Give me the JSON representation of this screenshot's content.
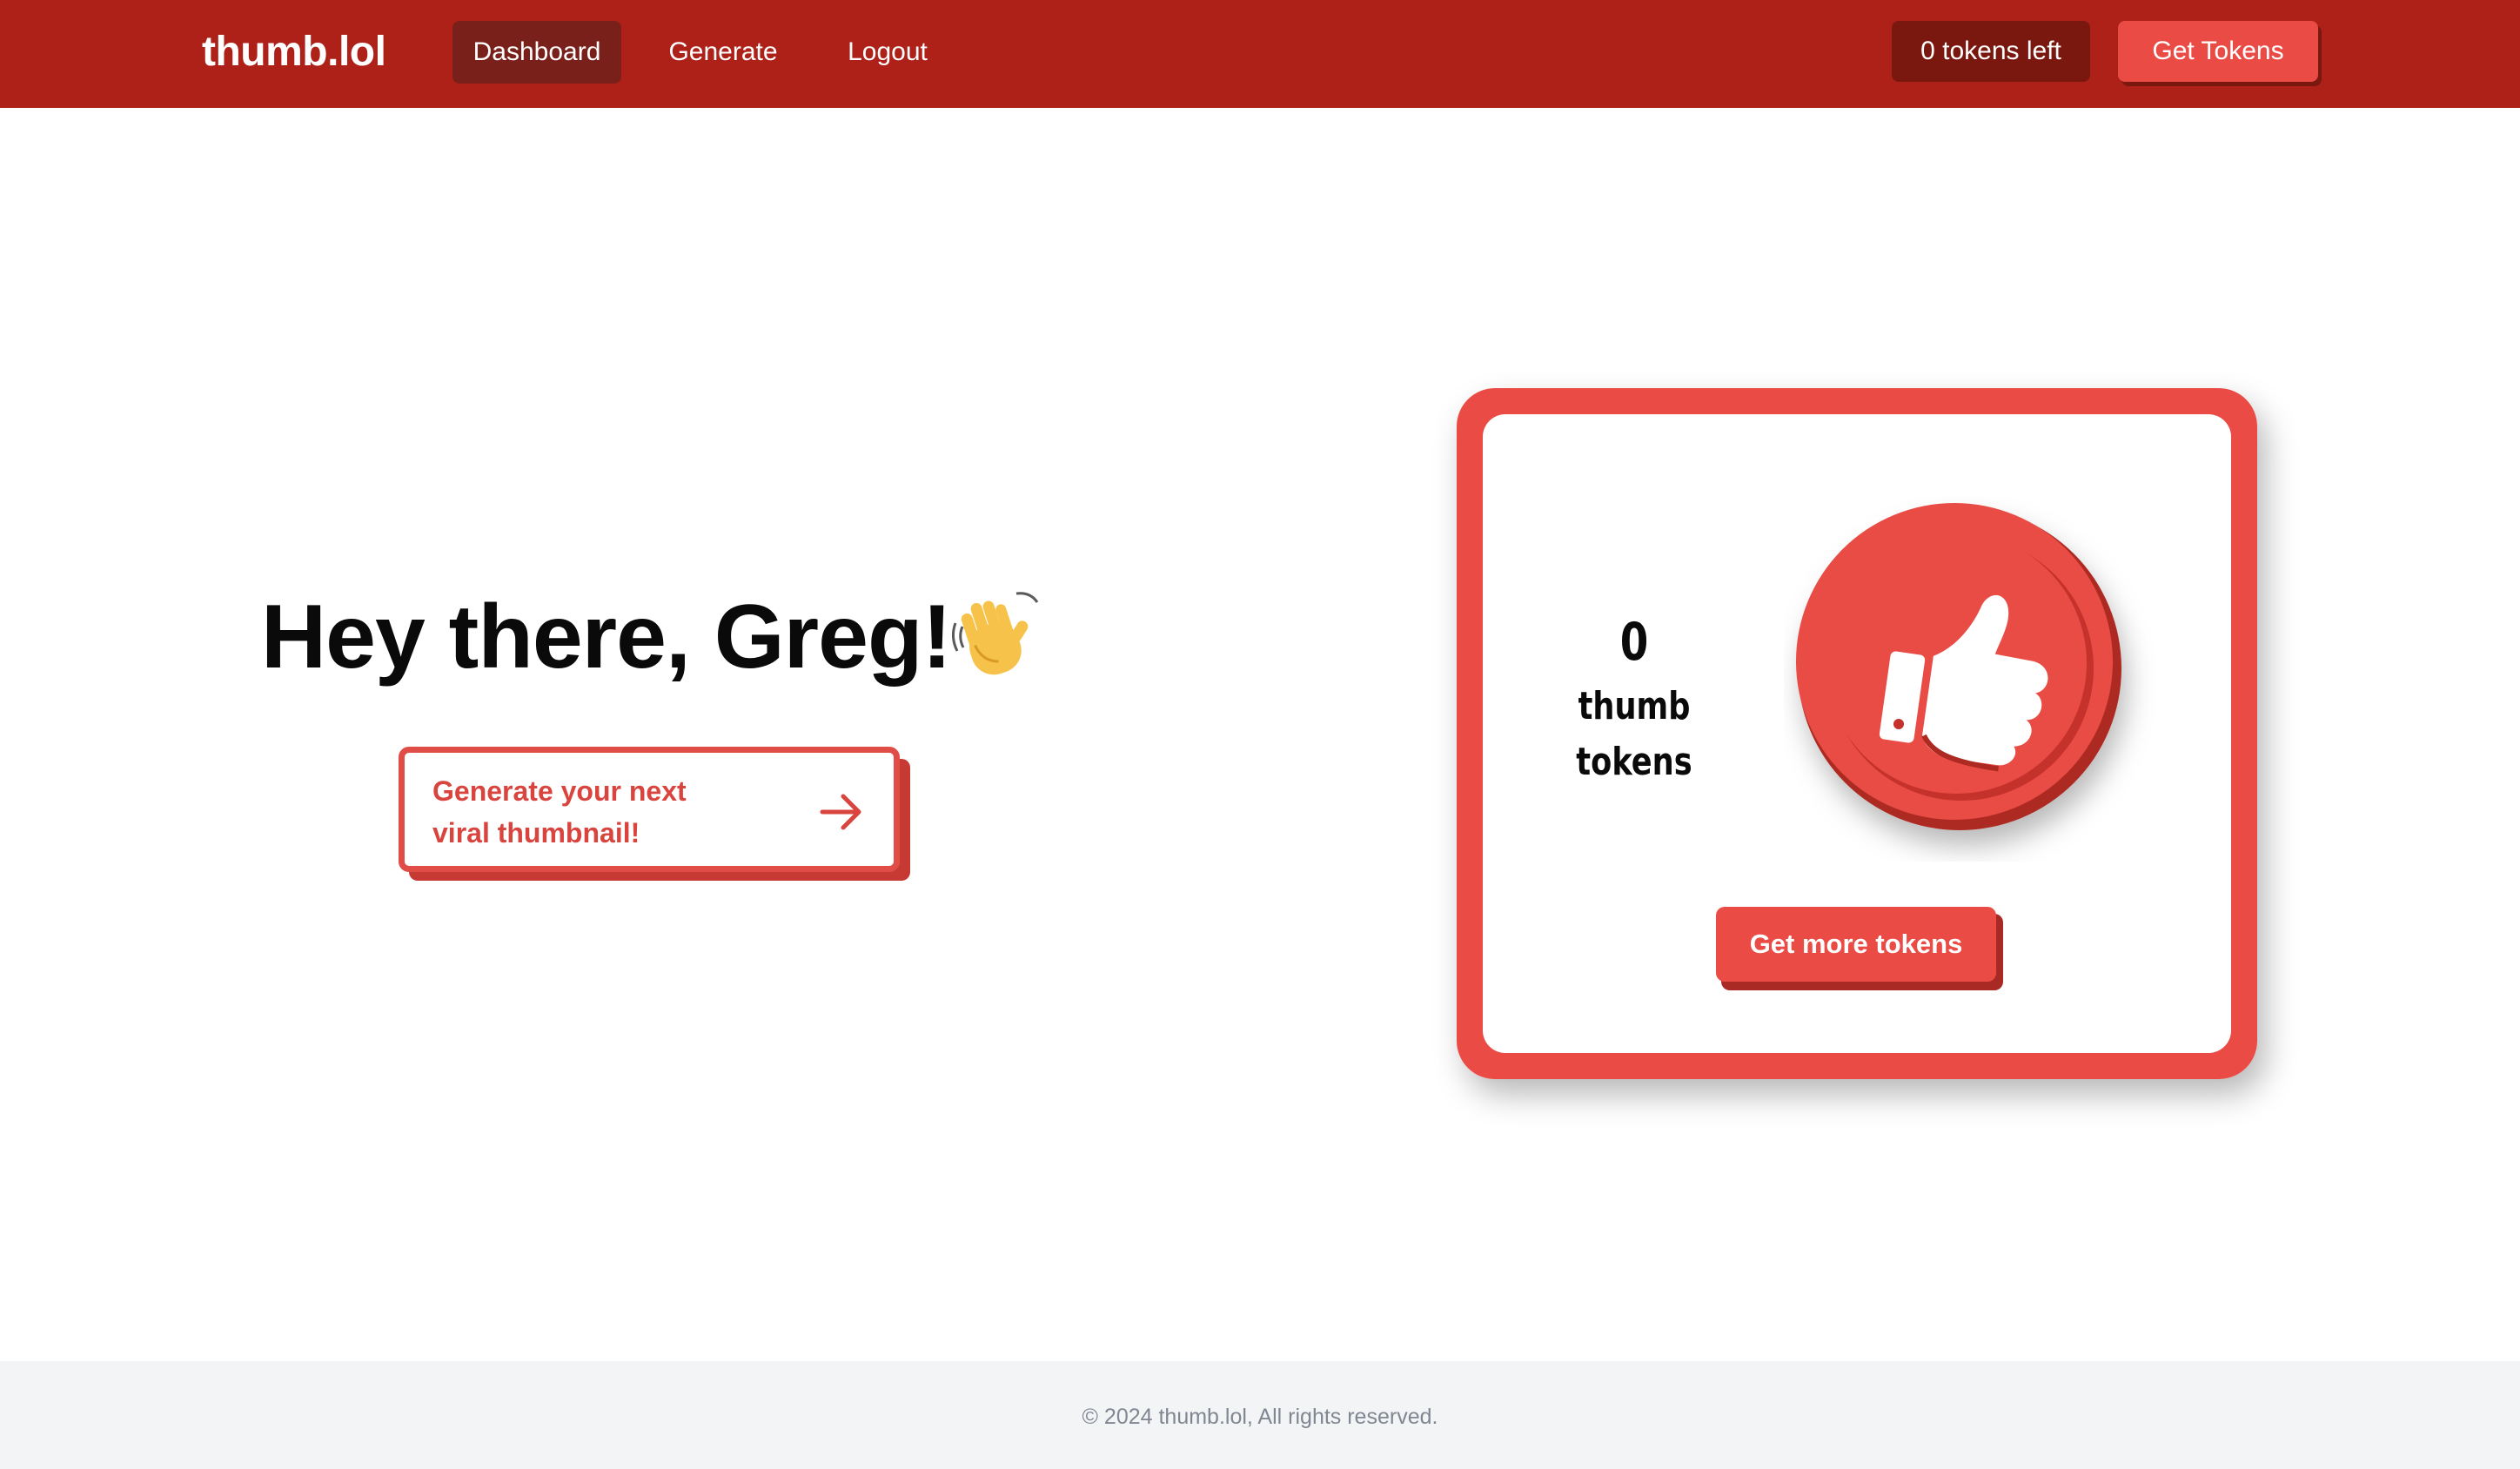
{
  "navbar": {
    "logo": "thumb.lol",
    "links": [
      {
        "label": "Dashboard",
        "active": true
      },
      {
        "label": "Generate",
        "active": false
      },
      {
        "label": "Logout",
        "active": false
      }
    ],
    "tokens_left": "0 tokens left",
    "get_tokens_label": "Get Tokens"
  },
  "main": {
    "greeting": "Hey there, Greg!",
    "greeting_icon": "waving-hand-icon",
    "cta": {
      "label": "Generate your next viral thumbnail!",
      "icon": "arrow-right-icon"
    }
  },
  "token_card": {
    "count": "0",
    "label": "thumb tokens",
    "coin_icon": "thumbs-up-icon",
    "button_label": "Get more tokens"
  },
  "footer": {
    "text": "© 2024 thumb.lol, All rights reserved."
  },
  "colors": {
    "navbar": "#ad2119",
    "nav_active": "#7a201a",
    "accent": "#ea4b45",
    "accent_dark": "#a92a24",
    "footer_bg": "#f3f4f6"
  }
}
